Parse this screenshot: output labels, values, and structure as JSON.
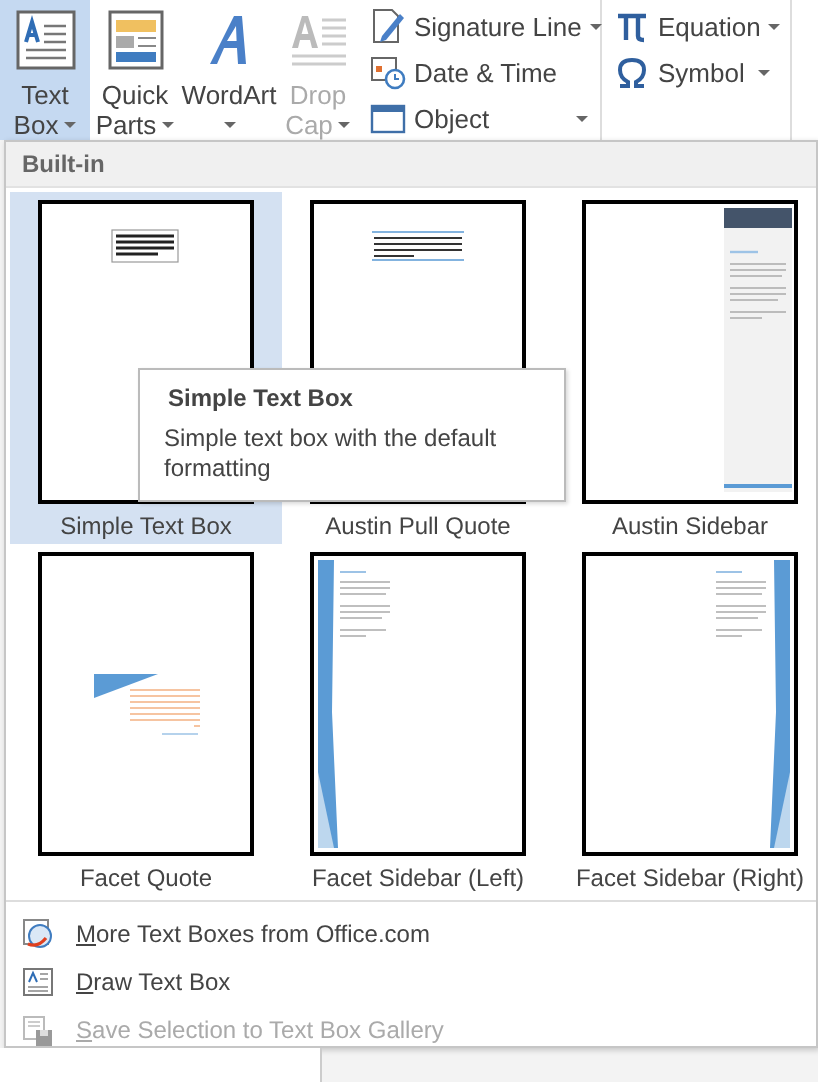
{
  "ribbon": {
    "large_buttons": [
      {
        "kind": "textbox",
        "lines": [
          "Text",
          "Box"
        ],
        "dropdown": true,
        "selected": true,
        "disabled": false
      },
      {
        "kind": "quickparts",
        "lines": [
          "Quick",
          "Parts"
        ],
        "dropdown": true,
        "selected": false,
        "disabled": false
      },
      {
        "kind": "wordart",
        "lines": [
          "WordArt"
        ],
        "dropdown": true,
        "selected": false,
        "disabled": false
      },
      {
        "kind": "dropcap",
        "lines": [
          "Drop",
          "Cap"
        ],
        "dropdown": true,
        "selected": false,
        "disabled": true
      }
    ],
    "small_buttons": [
      {
        "kind": "signature",
        "label": "Signature Line",
        "dropdown": true
      },
      {
        "kind": "datetime",
        "label": "Date & Time",
        "dropdown": false
      },
      {
        "kind": "object",
        "label": "Object",
        "dropdown": true
      }
    ],
    "symbol_buttons": [
      {
        "kind": "equation",
        "label": "Equation",
        "dropdown": true
      },
      {
        "kind": "symbol",
        "label": "Symbol",
        "dropdown": true
      }
    ]
  },
  "menu": {
    "section_title": "Built-in",
    "gallery": [
      {
        "kind": "simple",
        "label": "Simple Text Box",
        "selected": true
      },
      {
        "kind": "pullquote",
        "label": "Austin Pull Quote",
        "selected": false
      },
      {
        "kind": "sidebar",
        "label": "Austin Sidebar",
        "selected": false
      },
      {
        "kind": "facetquote",
        "label": "Facet Quote",
        "selected": false
      },
      {
        "kind": "facetleft",
        "label": "Facet Sidebar (Left)",
        "selected": false
      },
      {
        "kind": "facetright",
        "label": "Facet Sidebar (Right)",
        "selected": false
      }
    ],
    "tooltip": {
      "title": "Simple Text Box",
      "text": "Simple text box with the default formatting"
    },
    "commands": [
      {
        "kind": "online",
        "accel": "M",
        "label": "ore Text Boxes from Office.com",
        "disabled": false
      },
      {
        "kind": "draw",
        "accel": "D",
        "label": "raw Text Box",
        "disabled": false
      },
      {
        "kind": "save",
        "accel": "S",
        "label": "ave Selection to Text Box Gallery",
        "disabled": true
      }
    ]
  }
}
